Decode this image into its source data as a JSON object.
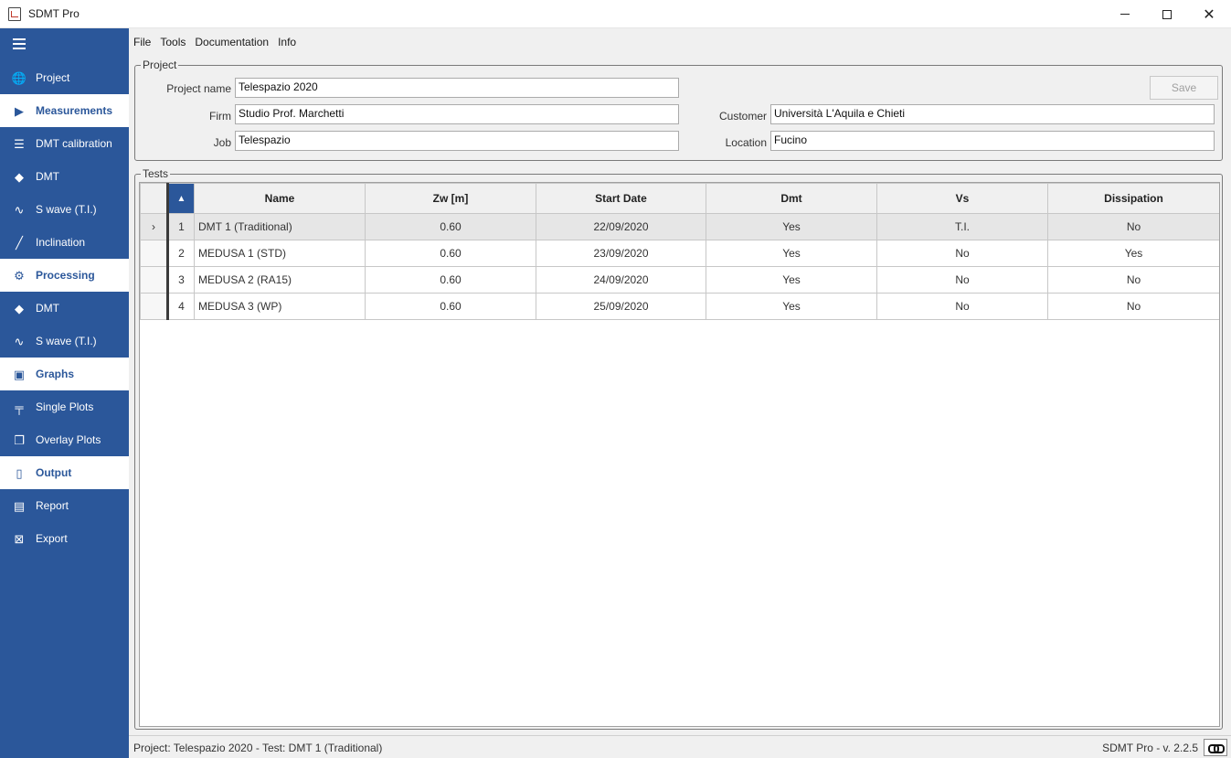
{
  "window": {
    "title": "SDMT Pro",
    "icons": {
      "app": "app-logo-icon",
      "minimize": "minimize-icon",
      "maximize": "maximize-icon",
      "close": "close-icon"
    },
    "close_glyph": "✕"
  },
  "sidebar": {
    "items": [
      {
        "key": "project",
        "label": "Project",
        "icon": "globe-icon",
        "glyph": "🌐",
        "type": "item"
      },
      {
        "key": "measurements",
        "label": "Measurements",
        "icon": "play-icon",
        "glyph": "▶",
        "type": "section"
      },
      {
        "key": "dmt-calibration",
        "label": "DMT calibration",
        "icon": "sliders-icon",
        "glyph": "☰",
        "type": "item"
      },
      {
        "key": "dmt",
        "label": "DMT",
        "icon": "blade-icon",
        "glyph": "◆",
        "type": "item"
      },
      {
        "key": "s-wave",
        "label": "S wave (T.I.)",
        "icon": "wave-icon",
        "glyph": "∿",
        "type": "item"
      },
      {
        "key": "inclination",
        "label": "Inclination",
        "icon": "slash-icon",
        "glyph": "╱",
        "type": "item"
      },
      {
        "key": "processing",
        "label": "Processing",
        "icon": "gears-icon",
        "glyph": "⚙",
        "type": "section"
      },
      {
        "key": "proc-dmt",
        "label": "DMT",
        "icon": "blade-icon",
        "glyph": "◆",
        "type": "item"
      },
      {
        "key": "proc-s-wave",
        "label": "S wave (T.I.)",
        "icon": "wave-icon",
        "glyph": "∿",
        "type": "item"
      },
      {
        "key": "graphs",
        "label": "Graphs",
        "icon": "image-icon",
        "glyph": "▣",
        "type": "section"
      },
      {
        "key": "single-plots",
        "label": "Single Plots",
        "icon": "pin-icon",
        "glyph": "╤",
        "type": "item"
      },
      {
        "key": "overlay-plots",
        "label": "Overlay Plots",
        "icon": "layers-icon",
        "glyph": "❐",
        "type": "item"
      },
      {
        "key": "output",
        "label": "Output",
        "icon": "document-icon",
        "glyph": "▯",
        "type": "section"
      },
      {
        "key": "report",
        "label": "Report",
        "icon": "pdf-icon",
        "glyph": "▤",
        "type": "item"
      },
      {
        "key": "export",
        "label": "Export",
        "icon": "excel-icon",
        "glyph": "⊠",
        "type": "item"
      }
    ]
  },
  "menu": {
    "items": [
      "File",
      "Tools",
      "Documentation",
      "Info"
    ]
  },
  "project": {
    "legend": "Project",
    "project_name_label": "Project name",
    "project_name": "Telespazio 2020",
    "firm_label": "Firm",
    "firm": "Studio Prof. Marchetti",
    "job_label": "Job",
    "job": "Telespazio",
    "customer_label": "Customer",
    "customer": "Università L'Aquila e Chieti",
    "location_label": "Location",
    "location": "Fucino",
    "save_label": "Save"
  },
  "tests": {
    "legend": "Tests",
    "sort_glyph": "▲",
    "selected_glyph": "›",
    "columns": [
      "Name",
      "Zw [m]",
      "Start Date",
      "Dmt",
      "Vs",
      "Dissipation"
    ],
    "rows": [
      {
        "n": "1",
        "name": "DMT 1 (Traditional)",
        "zw": "0.60",
        "date": "22/09/2020",
        "dmt": "Yes",
        "vs": "T.I.",
        "dissipation": "No",
        "selected": true
      },
      {
        "n": "2",
        "name": "MEDUSA 1 (STD)",
        "zw": "0.60",
        "date": "23/09/2020",
        "dmt": "Yes",
        "vs": "No",
        "dissipation": "Yes",
        "selected": false
      },
      {
        "n": "3",
        "name": "MEDUSA 2 (RA15)",
        "zw": "0.60",
        "date": "24/09/2020",
        "dmt": "Yes",
        "vs": "No",
        "dissipation": "No",
        "selected": false
      },
      {
        "n": "4",
        "name": "MEDUSA 3 (WP)",
        "zw": "0.60",
        "date": "25/09/2020",
        "dmt": "Yes",
        "vs": "No",
        "dissipation": "No",
        "selected": false
      }
    ]
  },
  "status": {
    "text": "Project: Telespazio 2020 - Test: DMT 1 (Traditional)",
    "version": "SDMT Pro - v. 2.2.5",
    "link_icon": "link-icon"
  },
  "colors": {
    "sidebar": "#2b579a",
    "accent": "#2b579a",
    "section_bg": "#ffffff",
    "panel_bg": "#f0f0f0"
  }
}
